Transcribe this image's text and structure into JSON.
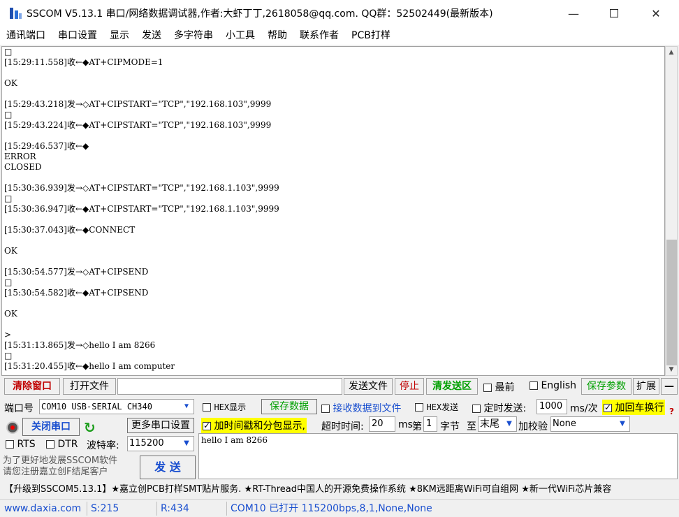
{
  "window": {
    "title": "SSCOM V5.13.1 串口/网络数据调试器,作者:大虾丁丁,2618058@qq.com. QQ群：52502449(最新版本)",
    "min_glyph": "—",
    "close_glyph": "✕"
  },
  "menu": [
    "通讯端口",
    "串口设置",
    "显示",
    "发送",
    "多字符串",
    "小工具",
    "帮助",
    "联系作者",
    "PCB打样"
  ],
  "log_lines": [
    "□",
    "[15:29:11.558]收←◆AT+CIPMODE=1",
    "",
    "OK",
    "",
    "[15:29:43.218]发→◇AT+CIPSTART=\"TCP\",\"192.168.103\",9999",
    "□",
    "[15:29:43.224]收←◆AT+CIPSTART=\"TCP\",\"192.168.103\",9999",
    "",
    "[15:29:46.537]收←◆",
    "ERROR",
    "CLOSED",
    "",
    "[15:30:36.939]发→◇AT+CIPSTART=\"TCP\",\"192.168.1.103\",9999",
    "□",
    "[15:30:36.947]收←◆AT+CIPSTART=\"TCP\",\"192.168.1.103\",9999",
    "",
    "[15:30:37.043]收←◆CONNECT",
    "",
    "OK",
    "",
    "[15:30:54.577]发→◇AT+CIPSEND",
    "□",
    "[15:30:54.582]收←◆AT+CIPSEND",
    "",
    "OK",
    "",
    ">",
    "[15:31:13.865]发→◇hello I am 8266",
    "□",
    "[15:31:20.455]收←◆hello I am computer"
  ],
  "toolbar": {
    "clear_window": "清除窗口",
    "open_file": "打开文件",
    "send_file": "发送文件",
    "stop": "停止",
    "clear_send_area": "清发送区",
    "topmost": "最前",
    "english": "English",
    "save_params": "保存参数",
    "expand": "扩展",
    "collapse": "—"
  },
  "port": {
    "label": "端口号",
    "value": "COM10 USB-SERIAL CH340",
    "close_port": "关闭串口",
    "more_settings": "更多串口设置",
    "rts": "RTS",
    "dtr": "DTR",
    "baud_label": "波特率:",
    "baud_value": "115200"
  },
  "options": {
    "hex_display": "HEX显示",
    "save_data": "保存数据",
    "recv_to_file": "接收数据到文件",
    "hex_send": "HEX发送",
    "timed_send": "定时发送:",
    "interval": "1000",
    "interval_unit": "ms/次",
    "add_crlf": "加回车换行",
    "timestamp": "加时间戳和分包显示,",
    "timeout_label": "超时时间:",
    "timeout_value": "20",
    "timeout_unit": "ms",
    "byte_no_prefix": "第",
    "byte_no": "1",
    "byte_label": "字节",
    "to_label": "至",
    "to_value": "末尾",
    "checksum_label": "加校验",
    "checksum_value": "None",
    "help_glyph": "?"
  },
  "send": {
    "text": "hello I am 8266",
    "promo": "为了更好地发展SSCOM软件\n请您注册嘉立创F结尾客户",
    "button": "发 送"
  },
  "marquee": "【升级到SSCOM5.13.1】★嘉立创PCB打样SMT贴片服务. ★RT-Thread中国人的开源免费操作系统 ★8KM远距离WiFi可自组网 ★新一代WiFi芯片兼容",
  "status": {
    "site": "www.daxia.com",
    "sent": "S:215",
    "received": "R:434",
    "port_state": "COM10 已打开  115200bps,8,1,None,None"
  }
}
